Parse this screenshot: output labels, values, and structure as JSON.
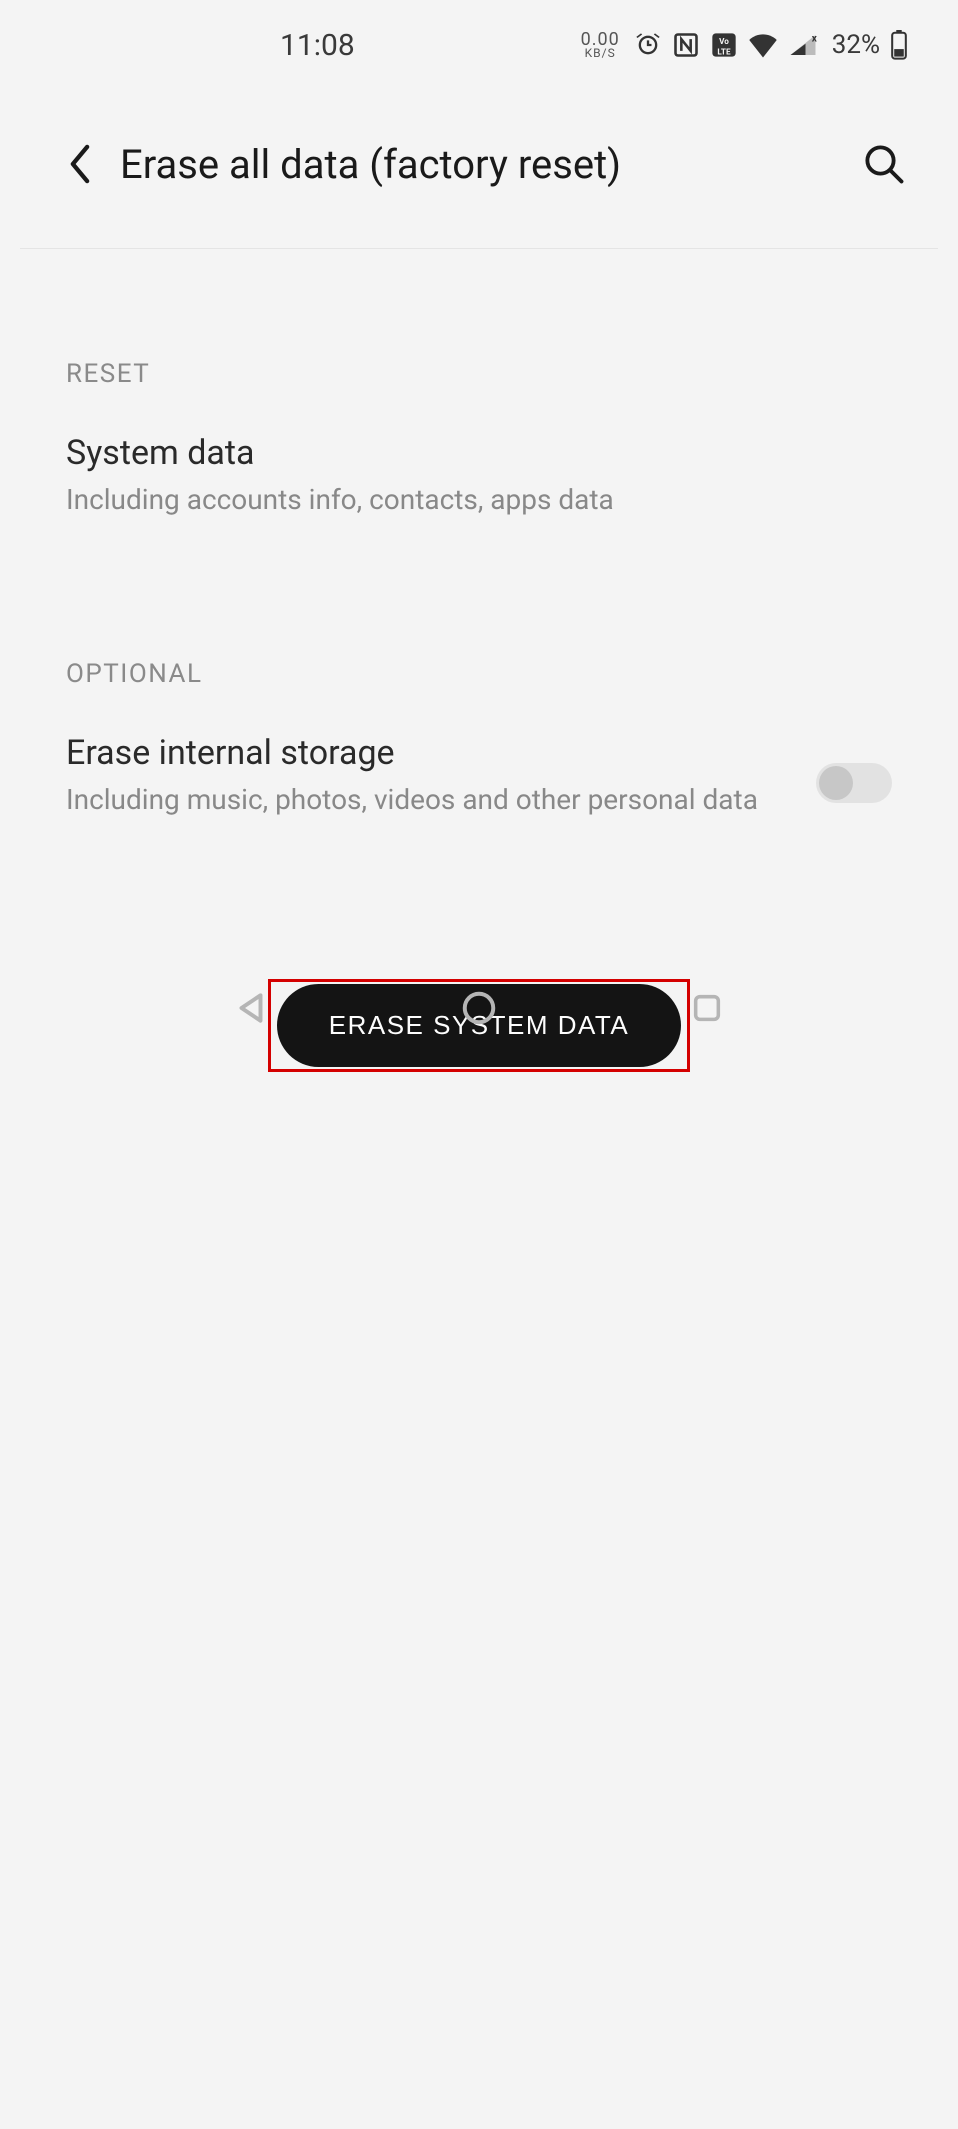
{
  "statusBar": {
    "time": "11:08",
    "netSpeedValue": "0.00",
    "netSpeedUnit": "KB/S",
    "batteryPercent": "32%"
  },
  "header": {
    "title": "Erase all data (factory reset)"
  },
  "sections": {
    "reset": {
      "label": "RESET",
      "item": {
        "title": "System data",
        "subtitle": "Including accounts info, contacts, apps data"
      }
    },
    "optional": {
      "label": "OPTIONAL",
      "item": {
        "title": "Erase internal storage",
        "subtitle": "Including music, photos, videos and other personal data",
        "toggle": false
      }
    }
  },
  "actions": {
    "eraseButton": "ERASE SYSTEM DATA"
  }
}
